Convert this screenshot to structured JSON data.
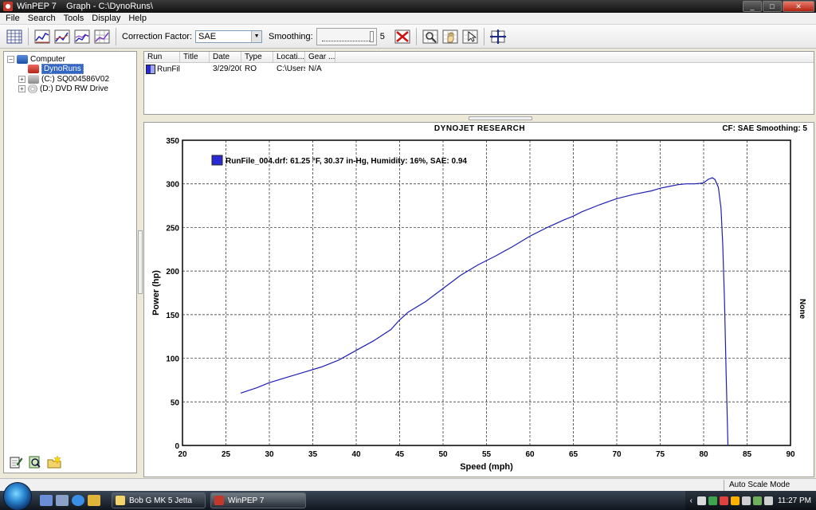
{
  "window": {
    "title": "WinPEP 7    Graph - C:\\DynoRuns\\",
    "controls": {
      "minimize": "_",
      "maximize": "□",
      "close": "✕"
    }
  },
  "menu": [
    "File",
    "Search",
    "Tools",
    "Display",
    "Help"
  ],
  "toolbar": {
    "correction_label": "Correction Factor:",
    "correction_value": "SAE",
    "smoothing_label": "Smoothing:",
    "smoothing_value": "5",
    "icons": [
      "grid-icon",
      "graph-3d-icon",
      "graph-line-icon",
      "graph-multi-icon",
      "graph-grid-icon",
      "remove-run-icon",
      "zoom-icon",
      "pan-hand-icon",
      "cursor-icon",
      "crosshair-icon"
    ]
  },
  "tree": {
    "root": "Computer",
    "selected_folder": "DynoRuns",
    "drives": [
      "(C:)  SQ004586V02",
      "(D:)  DVD RW Drive"
    ]
  },
  "runlist": {
    "columns": [
      "Run",
      "Title",
      "Date",
      "Type",
      "Locati...",
      "Gear ..."
    ],
    "rows": [
      {
        "run": "RunFil",
        "title": "",
        "date": "3/29/200",
        "type": "RO",
        "location": "C:\\Users'",
        "gear": "N/A"
      }
    ],
    "run_color": "#2a2ad2"
  },
  "graph": {
    "title": "DYNOJET RESEARCH",
    "cf_label": "CF: SAE  Smoothing: 5",
    "right_axis_label": "None",
    "legend": "RunFile_004.drf: 61.25 °F, 30.37 in-Hg, Humidity: 16%, SAE: 0.94"
  },
  "chart_data": {
    "type": "line",
    "xlabel": "Speed (mph)",
    "ylabel": "Power (hp)",
    "xlim": [
      20,
      90
    ],
    "ylim": [
      0,
      350
    ],
    "xticks": [
      20,
      25,
      30,
      35,
      40,
      45,
      50,
      55,
      60,
      65,
      70,
      75,
      80,
      85,
      90
    ],
    "yticks": [
      0,
      50,
      100,
      150,
      200,
      250,
      300,
      350
    ],
    "grid": true,
    "legend": "top-left",
    "series": [
      {
        "name": "RunFile_004.drf: 61.25 °F, 30.37 in-Hg, Humidity: 16%, SAE: 0.94",
        "color": "#1f1fb4",
        "x": [
          26.7,
          28.5,
          30,
          32,
          34,
          36,
          38,
          40,
          42,
          44,
          45,
          46,
          48,
          50,
          52,
          54,
          55,
          56,
          58,
          60,
          62,
          64,
          65,
          66,
          68,
          70,
          72,
          74,
          75,
          76,
          77,
          78,
          79,
          80,
          80.5,
          81,
          81.3,
          81.7,
          82,
          82.2,
          82.4,
          82.6,
          82.8
        ],
        "y": [
          60,
          66,
          72,
          78,
          84,
          90,
          98,
          109,
          120,
          133,
          144,
          153,
          165,
          180,
          195,
          207,
          212,
          217,
          228,
          240,
          250,
          259,
          263,
          268,
          276,
          283,
          288,
          292,
          295,
          297,
          299,
          300,
          300,
          301,
          305,
          307,
          305,
          296,
          272,
          230,
          165,
          80,
          0
        ]
      }
    ]
  },
  "status": {
    "mode": "Auto Scale Mode"
  },
  "taskbar": {
    "tasks": [
      "Bob G MK 5 Jetta",
      "WinPEP 7"
    ],
    "clock": "11:27 PM"
  }
}
